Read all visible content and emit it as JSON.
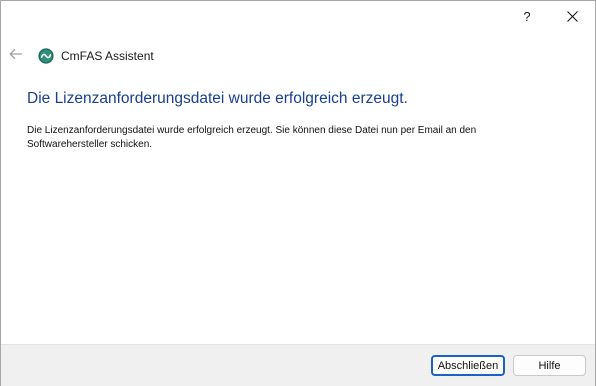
{
  "titlebar": {
    "help_label": "?",
    "close_icon": "close-icon"
  },
  "header": {
    "back_icon": "back-arrow-icon",
    "app_icon": "cmfas-logo-icon",
    "app_title": "CmFAS Assistent"
  },
  "main": {
    "heading": "Die Lizenzanforderungsdatei wurde erfolgreich erzeugt.",
    "body": "Die Lizenzanforderungsdatei wurde erfolgreich erzeugt. Sie können diese Datei nun per Email an den Softwarehersteller schicken."
  },
  "footer": {
    "finish_label": "Abschließen",
    "help_label": "Hilfe"
  },
  "colors": {
    "heading": "#1a3f8f",
    "logo": "#1f6b5a",
    "default_button_border": "#1a62c4"
  }
}
